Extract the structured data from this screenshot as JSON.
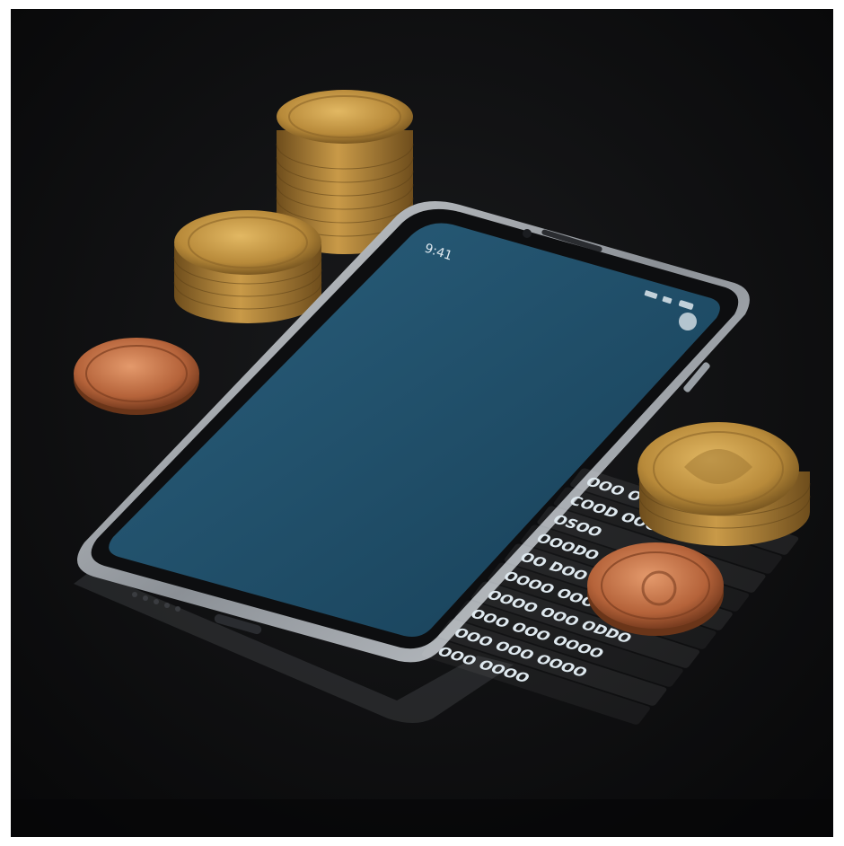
{
  "scene": {
    "subject": "smartphone",
    "surroundings": [
      "coins"
    ]
  },
  "colors": {
    "backdrop": "#0b0b0c",
    "screen": "#1f4f6b",
    "phone_frame": "#b9bdc2",
    "gold_coin": "#b88a3a",
    "copper_coin": "#b5633a",
    "screen_text": "#dfe9ef"
  },
  "phone": {
    "status_time": "9:41",
    "rows": [
      "OOO OOD",
      "COOD OOO",
      "OSOO",
      "OOODO  OOO  2",
      "OO  DOO OOOO",
      "OOOO  OOO OOOO",
      "OOOO OOO  ODDO",
      "OOO  OOO OOOO",
      "OOO OOO  OOOO",
      "OOO OOOO"
    ]
  }
}
